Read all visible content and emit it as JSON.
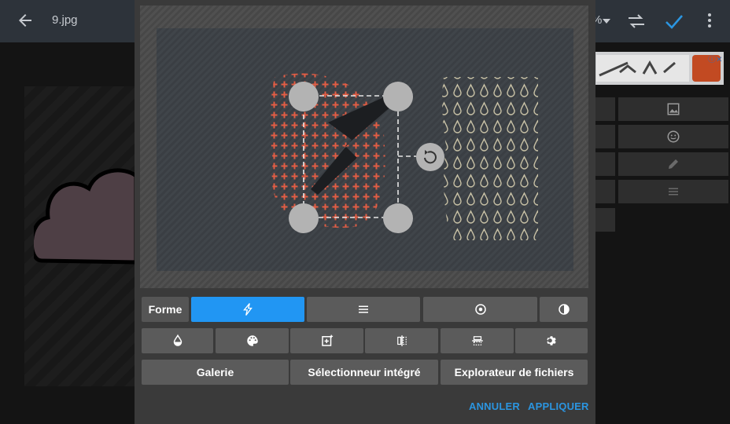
{
  "app_bar": {
    "filename": "9.jpg",
    "zoom_value": "%"
  },
  "ad": {
    "close_label": "ⓘ✕"
  },
  "dialog": {
    "tabs": {
      "forme_label": "Forme"
    },
    "source_buttons": {
      "gallery": "Galerie",
      "builtin_picker": "Sélectionneur intégré",
      "file_explorer": "Explorateur de fichiers"
    },
    "actions": {
      "cancel": "ANNULER",
      "apply": "APPLIQUER"
    }
  },
  "colors": {
    "accent": "#2196f3",
    "action_text": "#2b95e0",
    "pattern_orange": "#e35d44",
    "drop_outline": "#c9c2a6"
  }
}
